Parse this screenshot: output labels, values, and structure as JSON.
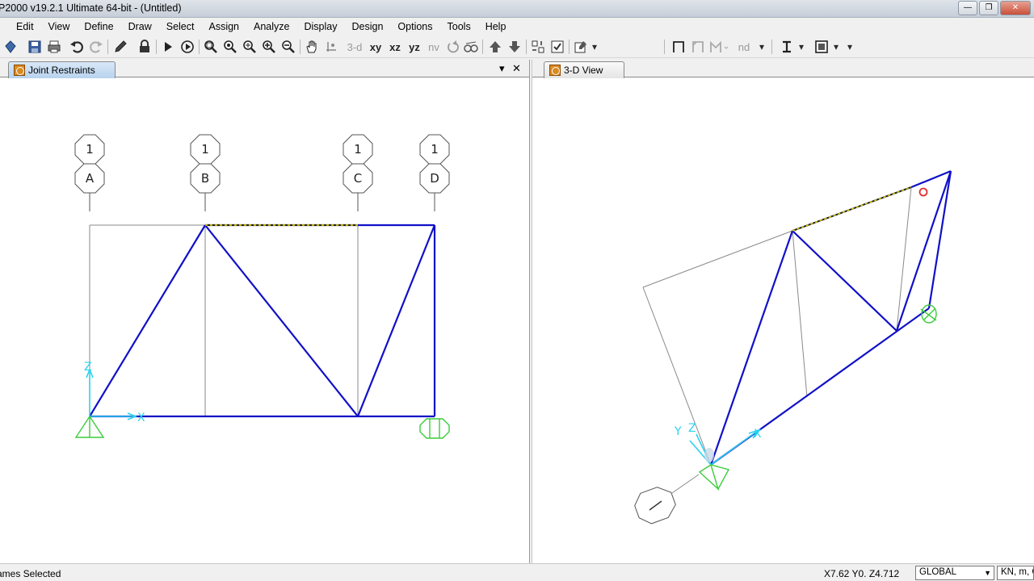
{
  "window": {
    "title": "P2000 v19.2.1 Ultimate 64-bit - (Untitled)",
    "min_glyph": "—",
    "max_glyph": "❐",
    "close_glyph": "✕"
  },
  "menu": [
    "Edit",
    "View",
    "Define",
    "Draw",
    "Select",
    "Assign",
    "Analyze",
    "Display",
    "Design",
    "Options",
    "Tools",
    "Help"
  ],
  "toolbar": {
    "view_3d": "3-d",
    "view_xy": "xy",
    "view_xz": "xz",
    "view_yz": "yz",
    "view_nv": "nv",
    "nd": "nd"
  },
  "left_pane": {
    "tab_title": "Joint Restraints",
    "dropdown_glyph": "▾",
    "close_glyph": "✕",
    "grid_bubbles": [
      {
        "top": "1",
        "bottom": "A"
      },
      {
        "top": "1",
        "bottom": "B"
      },
      {
        "top": "1",
        "bottom": "C"
      },
      {
        "top": "1",
        "bottom": "D"
      }
    ],
    "axis_x": "X",
    "axis_z": "Z"
  },
  "right_pane": {
    "tab_title": "3-D View",
    "axis_x": "X",
    "axis_y": "Y",
    "axis_z": "Z"
  },
  "status": {
    "selection": "ames Selected",
    "coords": "X7.62  Y0.  Z4.712",
    "coord_system": "GLOBAL",
    "units": "KN, m, C"
  },
  "colors": {
    "frame_blue": "#1010c8",
    "grid_gray": "#8a8a8a",
    "support_green": "#3ccc3c",
    "axis_cyan": "#2ad2f0",
    "selected_yellow": "#e8d800"
  }
}
